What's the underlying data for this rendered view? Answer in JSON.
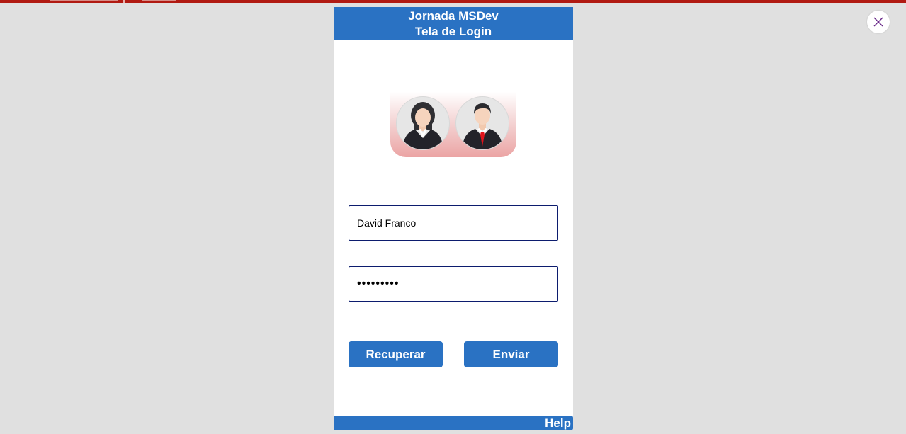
{
  "header": {
    "title_line1": "Jornada MSDev",
    "title_line2": "Tela de Login"
  },
  "avatars": {
    "left": "woman-avatar-icon",
    "right": "man-avatar-icon"
  },
  "form": {
    "username_value": "David Franco",
    "password_value": "•••••••••"
  },
  "buttons": {
    "recover_label": "Recuperar",
    "send_label": "Enviar"
  },
  "footer": {
    "help_label": "Help"
  },
  "colors": {
    "primary": "#2a72c3",
    "topbar": "#b11a12",
    "background": "#e0e0e0",
    "field_border": "#0c1c6e",
    "close_icon": "#6b2a8a"
  }
}
